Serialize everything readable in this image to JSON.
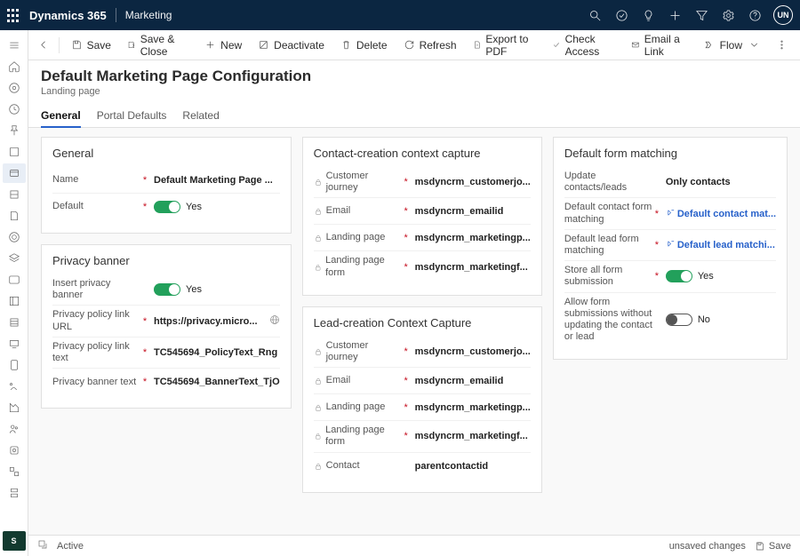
{
  "suite": {
    "brand": "Dynamics 365",
    "app": "Marketing",
    "avatar": "UN"
  },
  "commands": {
    "save": "Save",
    "saveClose": "Save & Close",
    "new": "New",
    "deactivate": "Deactivate",
    "delete": "Delete",
    "refresh": "Refresh",
    "exportPdf": "Export to PDF",
    "checkAccess": "Check Access",
    "emailLink": "Email a Link",
    "flow": "Flow"
  },
  "page": {
    "title": "Default Marketing Page Configuration",
    "subtitle": "Landing page"
  },
  "tabs": [
    "General",
    "Portal Defaults",
    "Related"
  ],
  "cards": {
    "general": {
      "title": "General",
      "name_lbl": "Name",
      "name_val": "Default Marketing Page ...",
      "default_lbl": "Default",
      "default_val": "Yes"
    },
    "privacy": {
      "title": "Privacy banner",
      "insert_lbl": "Insert privacy banner",
      "insert_val": "Yes",
      "url_lbl": "Privacy policy link URL",
      "url_val": "https://privacy.micro...",
      "text_lbl": "Privacy policy link text",
      "text_val": "TC545694_PolicyText_Rng",
      "banner_lbl": "Privacy banner text",
      "banner_val": "TC545694_BannerText_TjO"
    },
    "contactCapture": {
      "title": "Contact-creation context capture",
      "journey_lbl": "Customer journey",
      "journey_val": "msdyncrm_customerjo...",
      "email_lbl": "Email",
      "email_val": "msdyncrm_emailid",
      "lp_lbl": "Landing page",
      "lp_val": "msdyncrm_marketingp...",
      "lpf_lbl": "Landing page form",
      "lpf_val": "msdyncrm_marketingf..."
    },
    "leadCapture": {
      "title": "Lead-creation Context Capture",
      "journey_lbl": "Customer journey",
      "journey_val": "msdyncrm_customerjo...",
      "email_lbl": "Email",
      "email_val": "msdyncrm_emailid",
      "lp_lbl": "Landing page",
      "lp_val": "msdyncrm_marketingp...",
      "lpf_lbl": "Landing page form",
      "lpf_val": "msdyncrm_marketingf...",
      "contact_lbl": "Contact",
      "contact_val": "parentcontactid"
    },
    "matching": {
      "title": "Default form matching",
      "update_lbl": "Update contacts/leads",
      "update_val": "Only contacts",
      "contactMatch_lbl": "Default contact form matching",
      "contactMatch_val": "Default contact mat...",
      "leadMatch_lbl": "Default lead form matching",
      "leadMatch_val": "Default lead matchi...",
      "store_lbl": "Store all form submission",
      "store_val": "Yes",
      "allow_lbl": "Allow form submissions without updating the contact or lead",
      "allow_val": "No"
    }
  },
  "status": {
    "state": "Active",
    "dirty": "unsaved changes",
    "save": "Save"
  },
  "leftnav_badge": "S"
}
